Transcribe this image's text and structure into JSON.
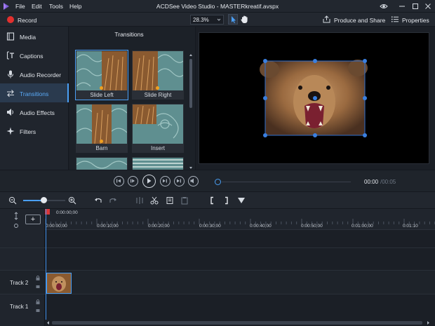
{
  "menu": [
    "File",
    "Edit",
    "Tools",
    "Help"
  ],
  "window_title": "ACDSee Video Studio - MASTERkreatif.avspx",
  "toolbar": {
    "record_label": "Record",
    "zoom_value": "28.3%",
    "produce_label": "Produce and Share",
    "properties_label": "Properties"
  },
  "sidebar": {
    "items": [
      {
        "label": "Media",
        "icon": "film-strip-icon"
      },
      {
        "label": "Captions",
        "icon": "captions-icon"
      },
      {
        "label": "Audio Recorder",
        "icon": "microphone-icon"
      },
      {
        "label": "Transitions",
        "icon": "transitions-icon",
        "active": true
      },
      {
        "label": "Audio Effects",
        "icon": "speaker-icon"
      },
      {
        "label": "Filters",
        "icon": "sparkle-icon"
      }
    ]
  },
  "transitions": {
    "title": "Transitions",
    "items": [
      "Slide Left",
      "Slide Right",
      "Barn",
      "Insert"
    ],
    "selected": "Slide Left"
  },
  "transport": {
    "time_current": "00:00",
    "time_total": "/00:05",
    "progress": 0
  },
  "timeline": {
    "playhead_time": "0:00:00;00",
    "ruler_labels": [
      "0:00:00;00",
      "0:00:10;00",
      "0:00:20;00",
      "0:00:30;00",
      "0:00:40;00",
      "0:00:50;00",
      "0:01:00;00",
      "0:01:10"
    ],
    "tracks": [
      "Track 2",
      "Track 1"
    ],
    "add_label": "+"
  },
  "colors": {
    "accent": "#4a9ff5",
    "record": "#e2302e",
    "background": "#1b1f26"
  }
}
